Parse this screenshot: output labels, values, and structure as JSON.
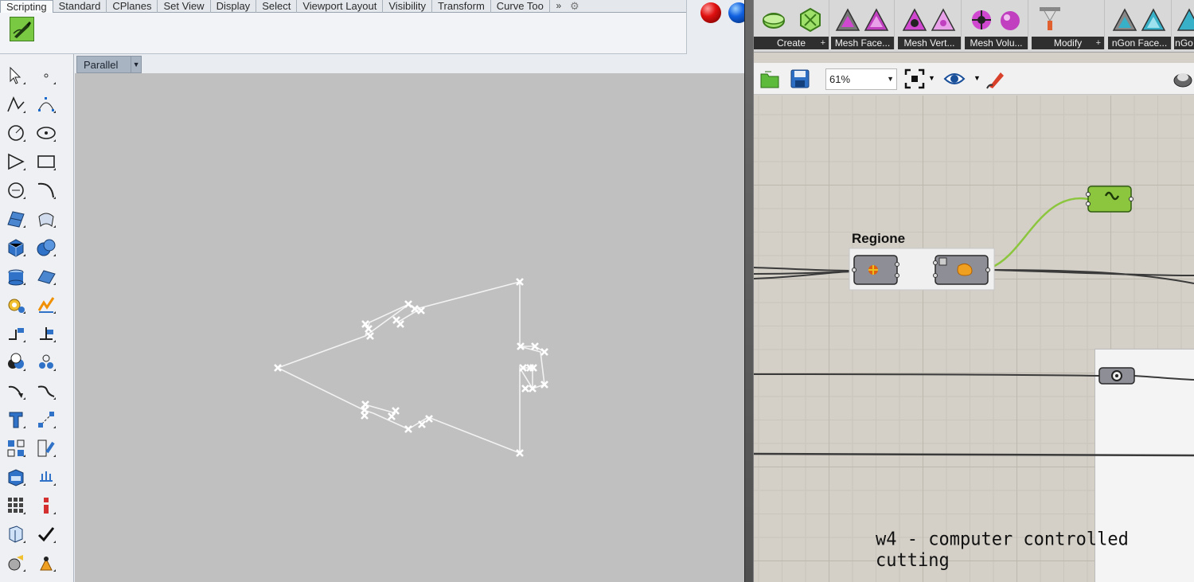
{
  "rhino": {
    "tabs": [
      "Scripting",
      "Standard",
      "CPlanes",
      "Set View",
      "Display",
      "Select",
      "Viewport Layout",
      "Visibility",
      "Transform",
      "Curve Too"
    ],
    "tab_more": "»",
    "viewport_label": "Parallel",
    "script_icon": "editor-pen-icon",
    "tool_icons": [
      "select-arrow-icon",
      "point-icon",
      "polyline-icon",
      "control-points-icon",
      "circle-icon",
      "ellipse-icon",
      "arc-icon",
      "rectangle-icon",
      "polygon-icon",
      "curve-icon",
      "surface-icon",
      "loft-icon",
      "box-icon",
      "sphere-icon",
      "cylinder-icon",
      "plane-icon",
      "gear-icon",
      "explode-icon",
      "extend-icon",
      "split-icon",
      "boolean-icon",
      "group-icon",
      "fillet-icon",
      "blend-icon",
      "text-icon",
      "dimension-icon",
      "array-icon",
      "transform-icon",
      "mesh-icon",
      "render-icon",
      "grid-icon",
      "layer-icon",
      "analyze-icon",
      "check-icon",
      "light-icon",
      "material-icon"
    ]
  },
  "grasshopper": {
    "ribbon_groups": [
      {
        "label": "Create",
        "plus": "+"
      },
      {
        "label": "Mesh Face...",
        "plus": ""
      },
      {
        "label": "Mesh Vert...",
        "plus": ""
      },
      {
        "label": "Mesh Volu...",
        "plus": ""
      },
      {
        "label": "Modify",
        "plus": "+"
      },
      {
        "label": "nGon Face...",
        "plus": ""
      },
      {
        "label": "nGo",
        "plus": ""
      }
    ],
    "zoom": "61%",
    "group_label": "Regione",
    "node_colors": {
      "component": "#8e8e96",
      "accent": "#8cc63f",
      "wire": "#3a3a3a"
    }
  },
  "caption": "w4 - computer controlled cutting"
}
